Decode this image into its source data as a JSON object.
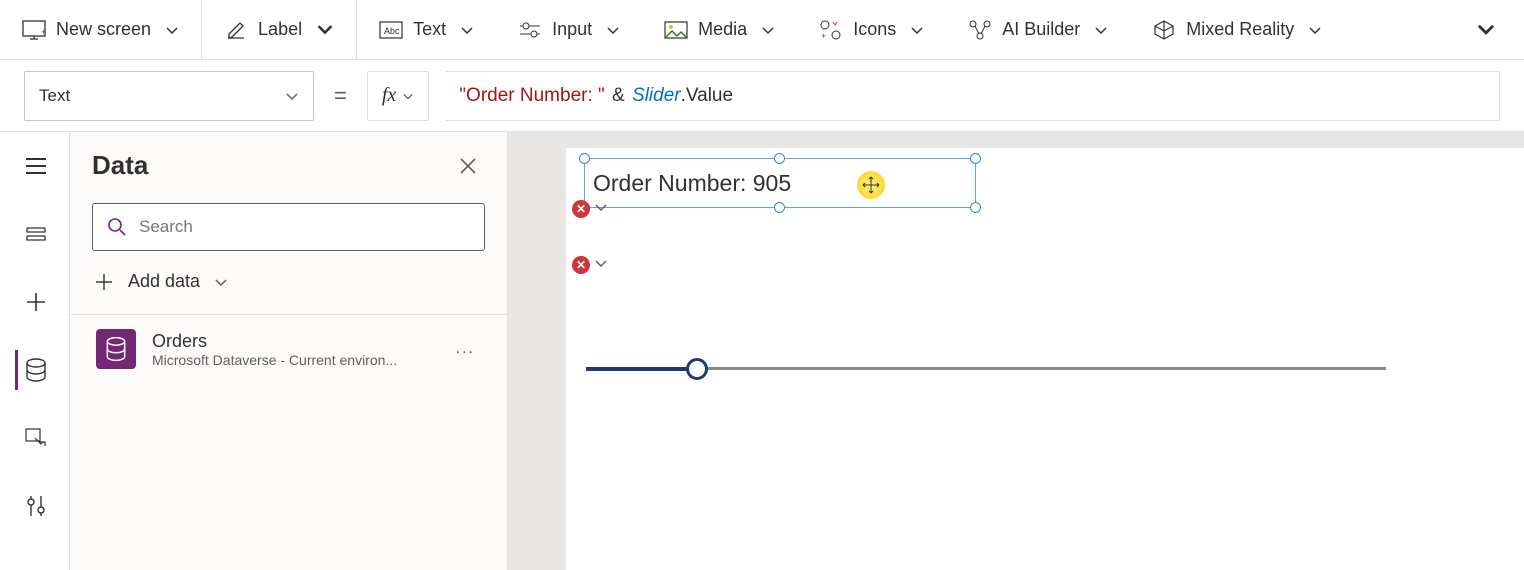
{
  "ribbon": {
    "new_screen": "New screen",
    "label": "Label",
    "text": "Text",
    "input": "Input",
    "media": "Media",
    "icons": "Icons",
    "ai_builder": "AI Builder",
    "mixed_reality": "Mixed Reality"
  },
  "formula_bar": {
    "property": "Text",
    "equals": "=",
    "fx": "fx",
    "formula_string": "\"Order Number: \"",
    "formula_op": "&",
    "formula_ident": "Slider",
    "formula_prop": ".Value"
  },
  "panel": {
    "title": "Data",
    "search_placeholder": "Search",
    "add_data": "Add data",
    "datasource": {
      "name": "Orders",
      "subtitle": "Microsoft Dataverse - Current environ..."
    }
  },
  "canvas": {
    "label_text": "Order Number: 905",
    "slider_value": 905
  }
}
